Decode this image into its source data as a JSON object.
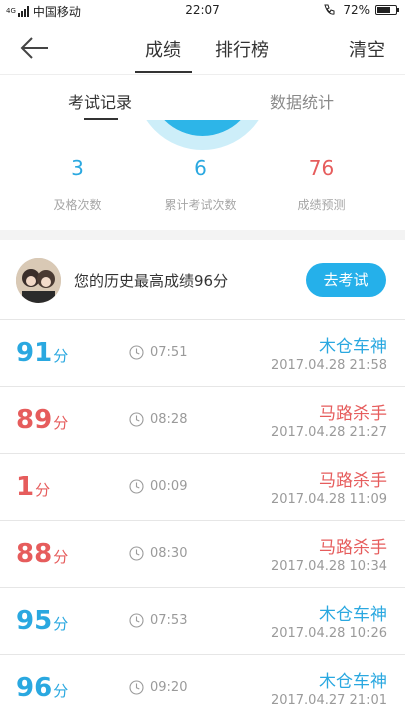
{
  "status_bar": {
    "network": "4G",
    "carrier": "中国移动",
    "time": "22:07",
    "battery_text": "72%",
    "battery_level": 0.72
  },
  "nav": {
    "tabs": [
      {
        "label": "成绩",
        "active": true
      },
      {
        "label": "排行榜",
        "active": false
      }
    ],
    "clear_label": "清空"
  },
  "sub_tabs": [
    {
      "label": "考试记录",
      "active": true
    },
    {
      "label": "数据统计",
      "active": false
    }
  ],
  "stats": [
    {
      "value": "3",
      "label": "及格次数",
      "color": "#2aa8e0"
    },
    {
      "value": "6",
      "label": "累计考试次数",
      "color": "#2aa8e0"
    },
    {
      "value": "76",
      "label": "成绩预测",
      "color": "#e65c5c"
    }
  ],
  "best": {
    "text": "您的历史最高成绩96分",
    "button_label": "去考试"
  },
  "records": [
    {
      "score": "91",
      "unit": "分",
      "duration": "07:51",
      "title": "木仓车神",
      "date": "2017.04.28  21:58",
      "pass": true
    },
    {
      "score": "89",
      "unit": "分",
      "duration": "08:28",
      "title": "马路杀手",
      "date": "2017.04.28  21:27",
      "pass": false
    },
    {
      "score": "1",
      "unit": "分",
      "duration": "00:09",
      "title": "马路杀手",
      "date": "2017.04.28  11:09",
      "pass": false
    },
    {
      "score": "88",
      "unit": "分",
      "duration": "08:30",
      "title": "马路杀手",
      "date": "2017.04.28  10:34",
      "pass": false
    },
    {
      "score": "95",
      "unit": "分",
      "duration": "07:53",
      "title": "木仓车神",
      "date": "2017.04.28  10:26",
      "pass": true
    },
    {
      "score": "96",
      "unit": "分",
      "duration": "09:20",
      "title": "木仓车神",
      "date": "2017.04.27  21:01",
      "pass": true
    }
  ],
  "colors": {
    "pass": "#2aa8e0",
    "fail": "#e65c5c",
    "accent": "#25b0ea"
  }
}
